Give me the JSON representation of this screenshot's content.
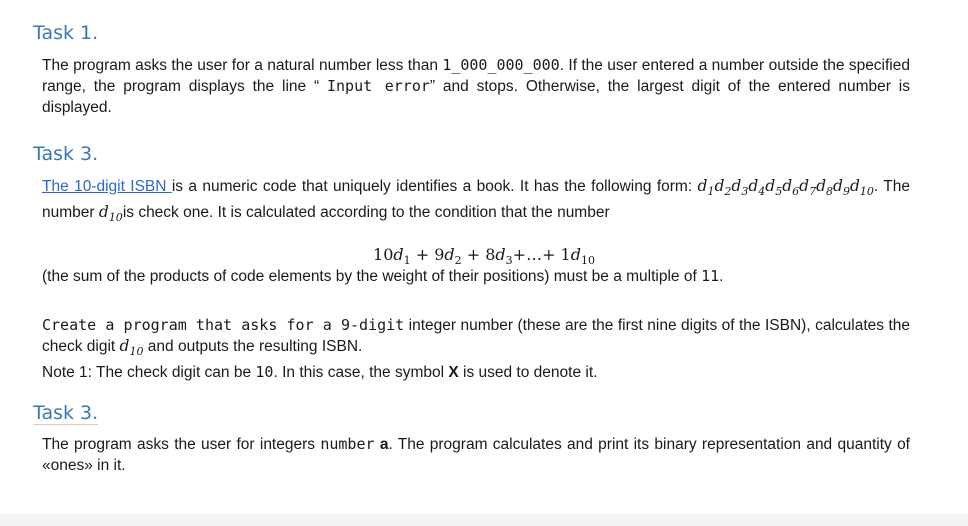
{
  "task1": {
    "heading": "Task 1.",
    "p1_a": "The program asks the user for a natural number less than ",
    "p1_num": "1_000_000_000",
    "p1_b": ". If the user entered a number outside the specified range, the program displays the line “ ",
    "p1_err": "Input error",
    "p1_c": "” and stops. Otherwise, the largest digit of the entered number is displayed."
  },
  "task2": {
    "heading": "Task 3.",
    "link": "The 10-digit ISBN ",
    "p_a": "is a numeric code that uniquely identifies a book. It has the following form: ",
    "form_digits": [
      "1",
      "2",
      "3",
      "4",
      "5",
      "6",
      "7",
      "8",
      "9",
      "10"
    ],
    "p_b": ". The number ",
    "p_c": "is check one. It is calculated according to the condition that the number",
    "formula": "10d₁ + 9d₂ + 8d₃+…+ 1d₁₀",
    "p_d": "(the sum of the products of code elements by the weight of their positions) must be a multiple of ",
    "p_d_num": "11",
    "p_d_end": ".",
    "create_mono": "Create a program that asks for a 9-digit",
    "create_rest": " integer number (these are the first nine digits of the ISBN), calculates the check digit ",
    "create_end": " and outputs the resulting ISBN.",
    "note_a": "Note 1: The check digit can be ",
    "note_num": "10",
    "note_b": ". In this case, the symbol ",
    "note_x": "X",
    "note_c": "  is used to denote it."
  },
  "task3": {
    "heading": "Task 3.",
    "p_a": "The program asks the user for integers ",
    "p_num": "number",
    "p_b": " a",
    "p_c": ". The program calculates and print its binary representation and quantity of «ones» in it."
  }
}
